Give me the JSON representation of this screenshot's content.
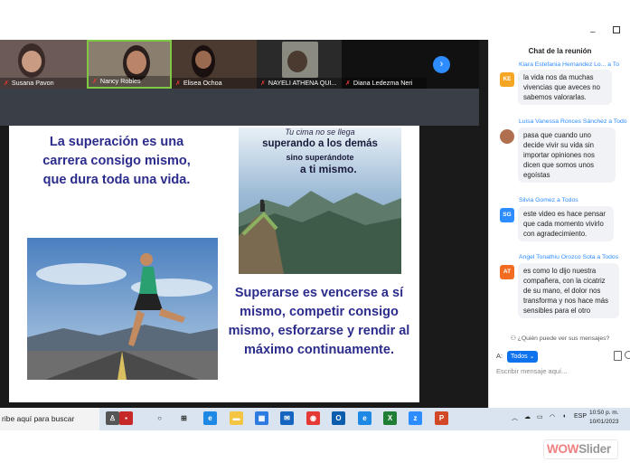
{
  "gallery": {
    "participants": [
      {
        "name": "Susana Pavon"
      },
      {
        "name": "Nancy Robles"
      },
      {
        "name": "Elisea Ochoa"
      },
      {
        "name": "NAYELI ATHENA QUI..."
      },
      {
        "name": "Diana Ledezma Neri",
        "tile_name": "Diana Ledezma..."
      }
    ],
    "next_icon": "chevron-right-icon"
  },
  "slide": {
    "text_top_left": "La superación es una carrera consigo mismo, que dura toda una vida.",
    "mountain_line0": "Tu cima no se llega",
    "mountain_line1": "superando a los demás",
    "mountain_line2": "sino superándote",
    "mountain_line3": "a ti mismo.",
    "text_bottom_right": "Superarse es vencerse a sí mismo, competir consigo mismo, esforzarse y rendir al máximo continuamente."
  },
  "taskbar": {
    "search_placeholder": "ribe aquí para buscar",
    "lang": "ESP",
    "time": "10:50 p. m.",
    "date": "10/01/2023"
  },
  "chat": {
    "title": "Chat de la reunión",
    "messages": [
      {
        "from": "Kiara Estefania Hernandez Lo...",
        "to": "a To",
        "initials": "KE",
        "avatar_color": "#f5a623",
        "text": "la vida nos da muchas vivencias que aveces no sabemos valorarlas."
      },
      {
        "from": "Luisa Vanessa Ronces Sánchez",
        "to": "a Todo",
        "initials": "",
        "avatar_color": "#b07050",
        "text": "pasa que cuando uno decide vivir su vida sin importar opiniones nos dicen que somos unos egoístas"
      },
      {
        "from": "Silvia Gomez",
        "to": "a Todos",
        "initials": "SG",
        "avatar_color": "#2d8cff",
        "text": "este video es hace pensar que cada momento vivirlo con agradecimiento."
      },
      {
        "from": "Angel Tonathiu Orozco Sota",
        "to": "a Todos",
        "initials": "AT",
        "avatar_color": "#f26d21",
        "text": "es como lo dijo nuestra compañera, con la cicatriz de su mano, el dolor nos transforma y nos hace más sensibles para el otro"
      }
    ],
    "who_can_see": "¿Quién puede ver sus mensajes?",
    "to_label": "A:",
    "to_value": "Todos",
    "input_placeholder": "Escribir mensaje aquí..."
  },
  "watermark": {
    "wow": "WOW",
    "slider": "Slider"
  }
}
